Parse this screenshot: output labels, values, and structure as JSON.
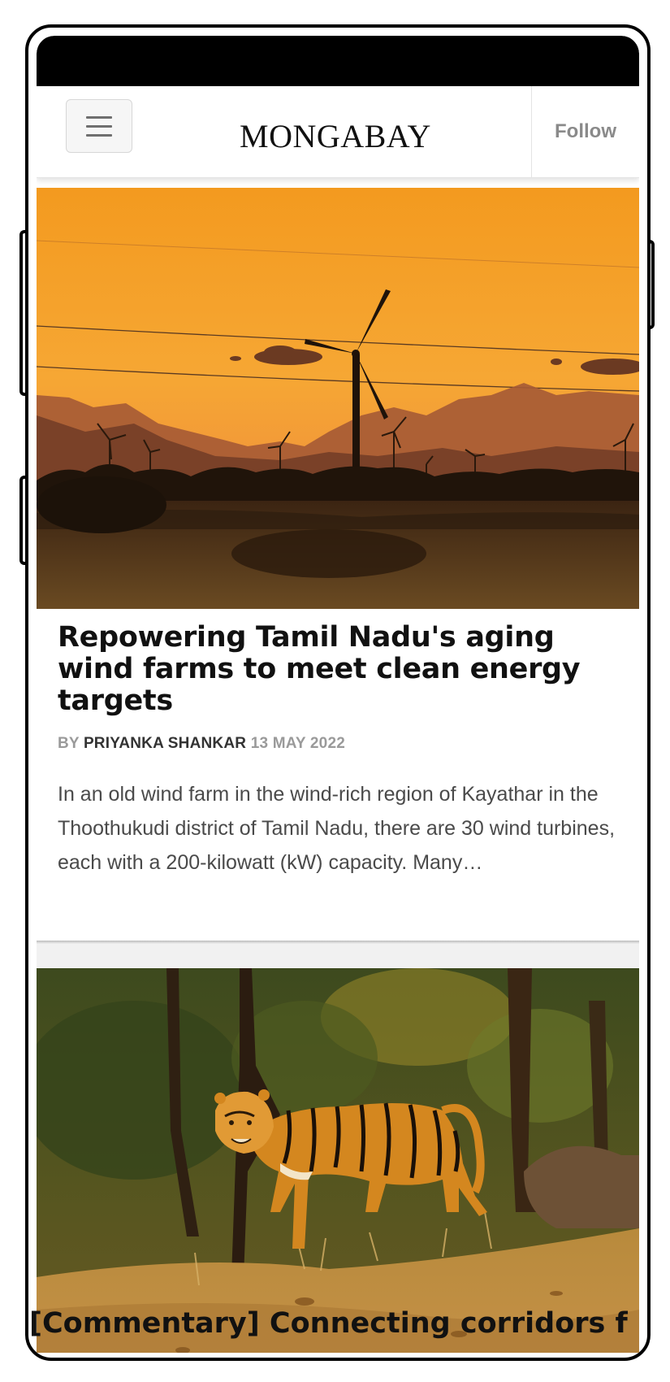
{
  "header": {
    "brand": "MONGABAY",
    "follow_label": "Follow"
  },
  "icons": {
    "menu": "hamburger-menu-icon"
  },
  "articles": [
    {
      "headline": "Repowering Tamil Nadu's aging wind farms to meet clean energy targets",
      "byline_prefix": "BY",
      "author": "PRIYANKA SHANKAR",
      "date": "13 MAY 2022",
      "excerpt": "In an old wind farm in the wind-rich region of Kayathar in the Thoothukudi district of Tamil Nadu, there are 30 wind turbines, each with a 200-kilowatt (kW) capacity. Many…",
      "image": "wind-turbines-sunset-photo"
    },
    {
      "headline_peek": "[Commentary] Connecting corridors f",
      "image": "tiger-in-forest-photo"
    }
  ]
}
